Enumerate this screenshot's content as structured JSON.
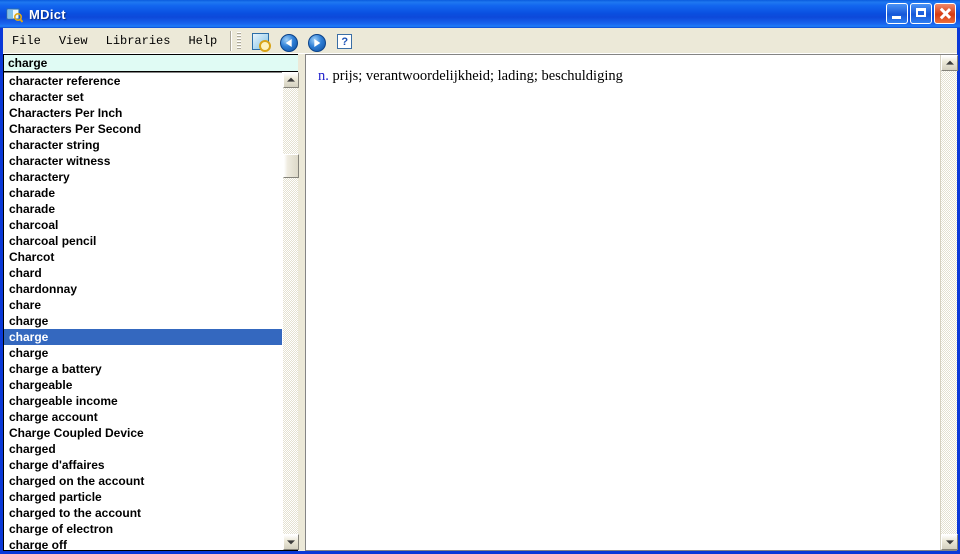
{
  "window": {
    "title": "MDict",
    "icon": "dictionary-book-icon",
    "caption_buttons": [
      {
        "name": "minimize",
        "label": "_"
      },
      {
        "name": "maximize",
        "label": "□"
      },
      {
        "name": "close",
        "label": "×"
      }
    ],
    "accent_titlebar": "#0a4fe0",
    "border_color": "#0a38d8"
  },
  "menu": {
    "items": [
      {
        "label": "File",
        "name": "menu-file"
      },
      {
        "label": "View",
        "name": "menu-view"
      },
      {
        "label": "Libraries",
        "name": "menu-libraries"
      },
      {
        "label": "Help",
        "name": "menu-help"
      }
    ]
  },
  "toolbar": {
    "buttons": [
      {
        "name": "search-dictionary-icon",
        "tooltip": "Search"
      },
      {
        "name": "back-arrow-icon",
        "tooltip": "Back"
      },
      {
        "name": "forward-arrow-icon",
        "tooltip": "Forward"
      },
      {
        "name": "help-question-icon",
        "label": "?",
        "tooltip": "Help"
      }
    ]
  },
  "search": {
    "value": "charge",
    "placeholder": "",
    "background": "#e0fbf4"
  },
  "word_list": {
    "selected_index": 16,
    "selection_color": "#3468bf",
    "items": [
      "character reference",
      "character set",
      "Characters Per Inch",
      "Characters Per Second",
      "character string",
      "character witness",
      "charactery",
      "charade",
      "charade",
      "charcoal",
      "charcoal pencil",
      "Charcot",
      "chard",
      "chardonnay",
      "chare",
      "charge",
      "charge",
      "charge",
      "charge a battery",
      "chargeable",
      "chargeable income",
      "charge account",
      "Charge Coupled Device",
      "charged",
      "charge d'affaires",
      "charged on the account",
      "charged particle",
      "charged to the account",
      "charge of electron",
      "charge off"
    ]
  },
  "definition": {
    "part_of_speech": "n.",
    "pos_color": "#2222cc",
    "text": " prijs; verantwoordelijkheid; lading; beschuldiging"
  }
}
